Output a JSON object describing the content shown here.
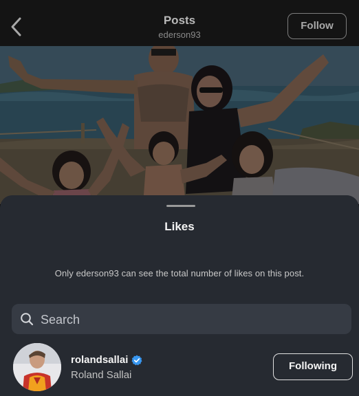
{
  "header": {
    "title": "Posts",
    "subtitle": "ederson93",
    "follow_label": "Follow"
  },
  "sheet": {
    "title": "Likes",
    "notice": "Only ederson93 can see the total number of likes on this post.",
    "search": {
      "placeholder": "Search"
    },
    "users": [
      {
        "username": "rolandsallai",
        "full_name": "Roland Sallai",
        "verified": true,
        "button_label": "Following"
      }
    ]
  },
  "colors": {
    "verified_badge": "#3897f0",
    "sheet_background": "#262a31"
  }
}
